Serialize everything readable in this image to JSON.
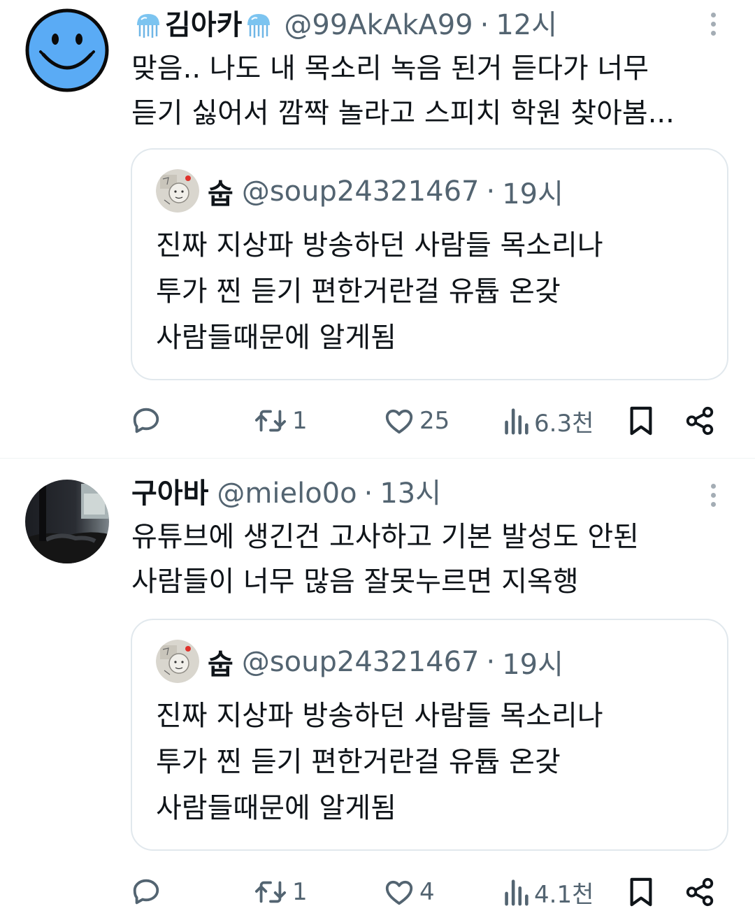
{
  "tweets": [
    {
      "author": {
        "name": "김아카",
        "handle": "@99AkAkA99",
        "time": "12시",
        "separator": "·",
        "name_decoration": "jellyfish-emoji",
        "avatar": "blue-smiley-face"
      },
      "text_lines": [
        "맞음.. 나도 내 목소리 녹음 된거 듣다가 너무",
        "듣기 싫어서 깜짝 놀라고 스피치 학원 찾아봄..."
      ],
      "quote": {
        "name": "숩",
        "handle": "@soup24321467",
        "separator": "·",
        "time": "19시",
        "text_lines": [
          "진짜 지상파 방송하던 사람들 목소리나",
          "투가 찐 듣기 편한거란걸 유튭 온갖",
          "사람들때문에 알게됨"
        ]
      },
      "actions": {
        "reply": "",
        "retweets": "1",
        "likes": "25",
        "views": "6.3천"
      }
    },
    {
      "author": {
        "name": "구아바",
        "handle": "@mielo0o",
        "time": "13시",
        "separator": "·",
        "avatar": "dark-room-photo"
      },
      "text_lines": [
        "유튜브에 생긴건 고사하고 기본 발성도 안된",
        "사람들이 너무 많음 잘못누르면 지옥행"
      ],
      "quote": {
        "name": "숩",
        "handle": "@soup24321467",
        "separator": "·",
        "time": "19시",
        "text_lines": [
          "진짜 지상파 방송하던 사람들 목소리나",
          "투가 찐 듣기 편한거란걸 유튭 온갖",
          "사람들때문에 알게됨"
        ]
      },
      "actions": {
        "reply": "",
        "retweets": "1",
        "likes": "4",
        "views": "4.1천"
      }
    }
  ],
  "icons": {
    "reply": "reply-icon",
    "retweet": "retweet-icon",
    "like": "heart-icon",
    "views": "views-icon",
    "bookmark": "bookmark-icon",
    "share": "share-icon",
    "more": "more-icon"
  },
  "colors": {
    "text": "#0f1419",
    "secondary": "#536471",
    "border": "#e1e8ed",
    "avatar_blue": "#5aabf5"
  }
}
